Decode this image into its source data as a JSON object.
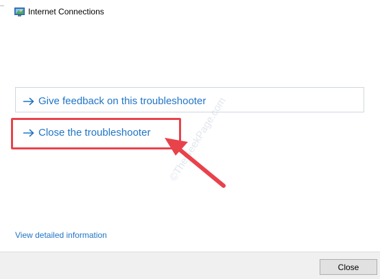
{
  "window": {
    "title": "Internet Connections",
    "icon": "network-troubleshooter-icon"
  },
  "options": [
    {
      "label": "Give feedback on this troubleshooter",
      "icon": "right-arrow-icon"
    },
    {
      "label": "Close the troubleshooter",
      "icon": "right-arrow-icon"
    }
  ],
  "annotation": {
    "highlight_color": "#e8424b",
    "watermark_text": "©TheGeekPage.com"
  },
  "links": {
    "view_detailed": "View detailed information"
  },
  "footer": {
    "close_label": "Close"
  },
  "colors": {
    "link_blue": "#1f74c6",
    "annotation_red": "#e8424b"
  }
}
